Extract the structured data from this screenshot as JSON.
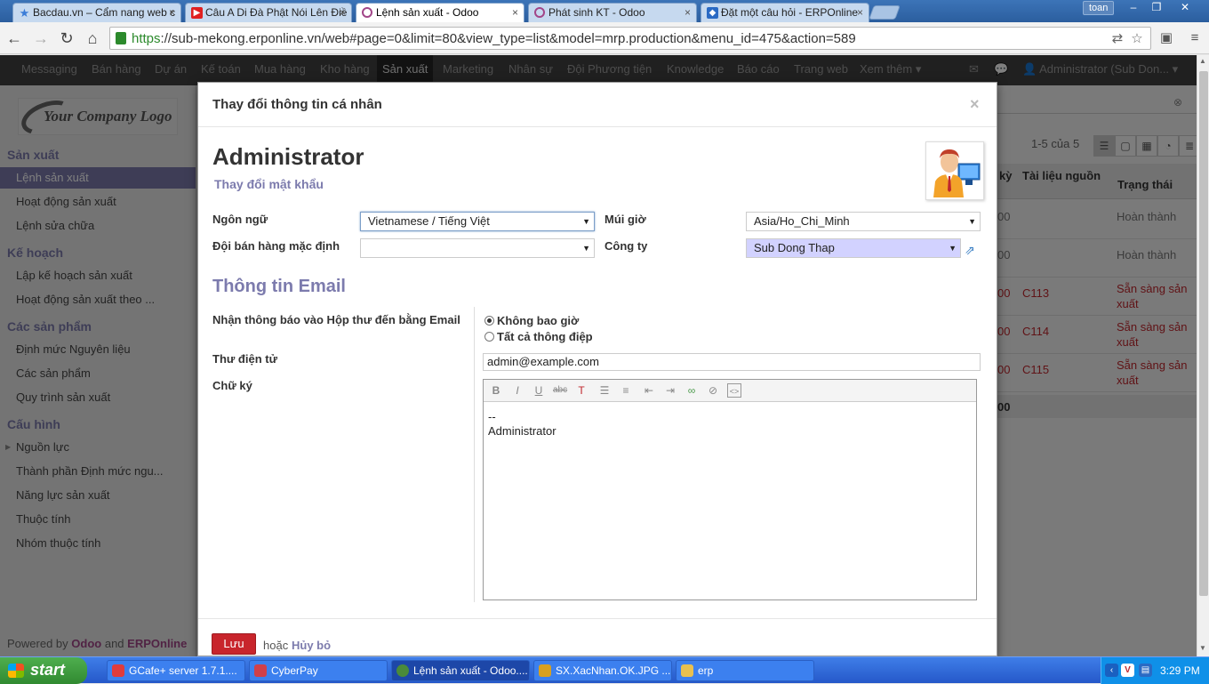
{
  "browser": {
    "tabs": [
      {
        "label": "Bacdau.vn – Cẩm nang web c",
        "icon_color": "#3b7dd8",
        "icon": "star-icon"
      },
      {
        "label": "Câu A Di Đà Phật Nói Lên Điề",
        "icon_color": "#e02020",
        "icon": "youtube-icon"
      },
      {
        "label": "Lệnh sản xuất - Odoo",
        "icon_color": "#a24689",
        "icon": "odoo-icon"
      },
      {
        "label": "Phát sinh KT - Odoo",
        "icon_color": "#a24689",
        "icon": "odoo-icon"
      },
      {
        "label": "Đặt một câu hỏi - ERPOnline",
        "icon_color": "#2a6ac4",
        "icon": "erponline-icon"
      }
    ],
    "user": "toan",
    "url_scheme": "https",
    "url_rest": "://sub-mekong.erponline.vn/web#page=0&limit=80&view_type=list&model=mrp.production&menu_id=475&action=589"
  },
  "topmenu": {
    "items": [
      "Messaging",
      "Bán hàng",
      "Dự án",
      "Kế toán",
      "Mua hàng",
      "Kho hàng",
      "Sản xuất",
      "Marketing",
      "Nhân sự",
      "Đội Phương tiện",
      "Knowledge",
      "Báo cáo",
      "Trang web",
      "Xem thêm ▾"
    ],
    "active_index": 6,
    "user_label": "Administrator (Sub Don..."
  },
  "sidebar": {
    "logo_text": "Your Company Logo",
    "sections": [
      {
        "title": "Sản xuất",
        "items": [
          "Lệnh sản xuất",
          "Hoạt động sản xuất",
          "Lệnh sửa chữa"
        ]
      },
      {
        "title": "Kế hoạch",
        "items": [
          "Lập kế hoạch sản xuất",
          "Hoạt động sản xuất theo ..."
        ]
      },
      {
        "title": "Các sản phẩm",
        "items": [
          "Định mức Nguyên liệu",
          "Các sản phẩm",
          "Quy trình sản xuất"
        ]
      },
      {
        "title": "Cấu hình",
        "items": [
          "Nguồn lực",
          "Thành phần Định mức ngu...",
          "Năng lực sản xuất",
          "Thuộc tính",
          "Nhóm thuộc tính"
        ]
      }
    ],
    "active_item": "Lệnh sản xuất",
    "powered_prefix": "Powered by",
    "powered_odoo": "Odoo",
    "powered_and": "and",
    "powered_erp": "ERPOnline"
  },
  "list": {
    "pager": "1-5 của 5",
    "col_partial": "kỳ",
    "col_source": "Tài liệu nguồn",
    "col_state": "Trạng thái",
    "rows": [
      {
        "partial": "00",
        "source": "",
        "state": "Hoàn thành",
        "style": "gray"
      },
      {
        "partial": "00",
        "source": "",
        "state": "Hoàn thành",
        "style": "gray"
      },
      {
        "partial": "00",
        "source": "C113",
        "state": "Sẵn sàng sản xuất",
        "style": "red"
      },
      {
        "partial": "00",
        "source": "C114",
        "state": "Sẵn sàng sản xuất",
        "style": "red"
      },
      {
        "partial": "00",
        "source": "C115",
        "state": "Sẵn sàng sản xuất",
        "style": "red"
      }
    ],
    "footer_partial": "00"
  },
  "modal": {
    "title": "Thay đổi thông tin cá nhân",
    "close": "×",
    "name": "Administrator",
    "change_password": "Thay đổi mật khẩu",
    "language_label": "Ngôn ngữ",
    "language_value": "Vietnamese / Tiếng Việt",
    "timezone_label": "Múi giờ",
    "timezone_value": "Asia/Ho_Chi_Minh",
    "sales_team_label": "Đội bán hàng mặc định",
    "sales_team_value": "",
    "company_label": "Công ty",
    "company_value": "Sub Dong Thap",
    "email_section": "Thông tin Email",
    "notify_label": "Nhận thông báo vào Hộp thư đến bằng Email",
    "notify_options": [
      "Không bao giờ",
      "Tất cả thông điệp"
    ],
    "notify_selected": 0,
    "email_label": "Thư điện tử",
    "email_value": "admin@example.com",
    "signature_label": "Chữ ký",
    "signature_line1": "--",
    "signature_line2": "Administrator",
    "save_label": "Lưu",
    "or_label": "hoặc",
    "cancel_label": "Hủy bỏ"
  },
  "taskbar": {
    "start_label": "start",
    "items": [
      {
        "label": "GCafe+ server 1.7.1....",
        "color": "#e03c3c"
      },
      {
        "label": "CyberPay",
        "color": "#d0404a"
      },
      {
        "label": "Lệnh sản xuất - Odoo....",
        "color": "#4a8a3a"
      },
      {
        "label": "SX.XacNhan.OK.JPG ...",
        "color": "#d8a020"
      },
      {
        "label": "erp",
        "color": "#e8c050"
      }
    ],
    "active_index": 2,
    "time": "3:29 PM"
  }
}
